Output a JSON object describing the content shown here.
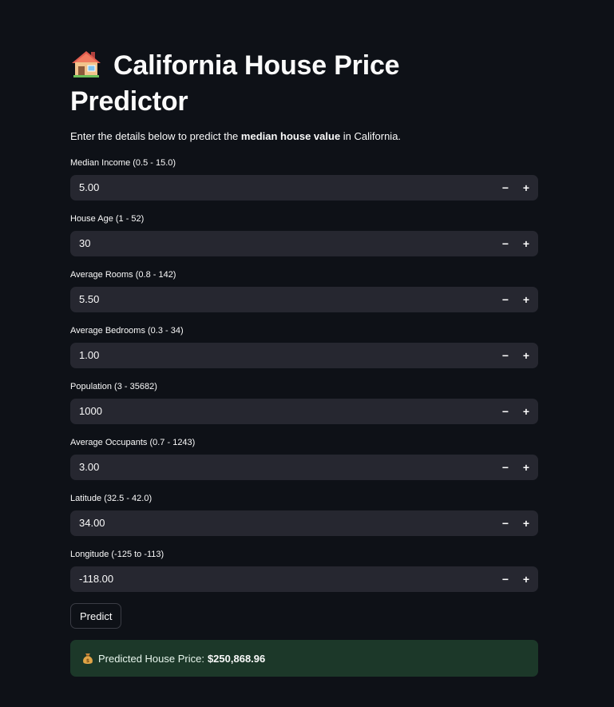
{
  "header": {
    "title": "California House Price Predictor",
    "title_icon": "house-icon"
  },
  "intro": {
    "before": "Enter the details below to predict the ",
    "bold": "median house value",
    "after": " in California."
  },
  "fields": [
    {
      "label": "Median Income (0.5 - 15.0)",
      "value": "5.00"
    },
    {
      "label": "House Age (1 - 52)",
      "value": "30"
    },
    {
      "label": "Average Rooms (0.8 - 142)",
      "value": "5.50"
    },
    {
      "label": "Average Bedrooms (0.3 - 34)",
      "value": "1.00"
    },
    {
      "label": "Population (3 - 35682)",
      "value": "1000"
    },
    {
      "label": "Average Occupants (0.7 - 1243)",
      "value": "3.00"
    },
    {
      "label": "Latitude (32.5 - 42.0)",
      "value": "34.00"
    },
    {
      "label": "Longitude (-125 to -113)",
      "value": "-118.00"
    }
  ],
  "stepper": {
    "minus": "−",
    "plus": "+"
  },
  "predict_button": {
    "label": "Predict"
  },
  "result": {
    "icon": "money-bag-icon",
    "label": "Predicted House Price:",
    "value": "$250,868.96"
  },
  "colors": {
    "background": "#0e1117",
    "input_bg": "#262730",
    "success_bg": "#1c3829"
  }
}
